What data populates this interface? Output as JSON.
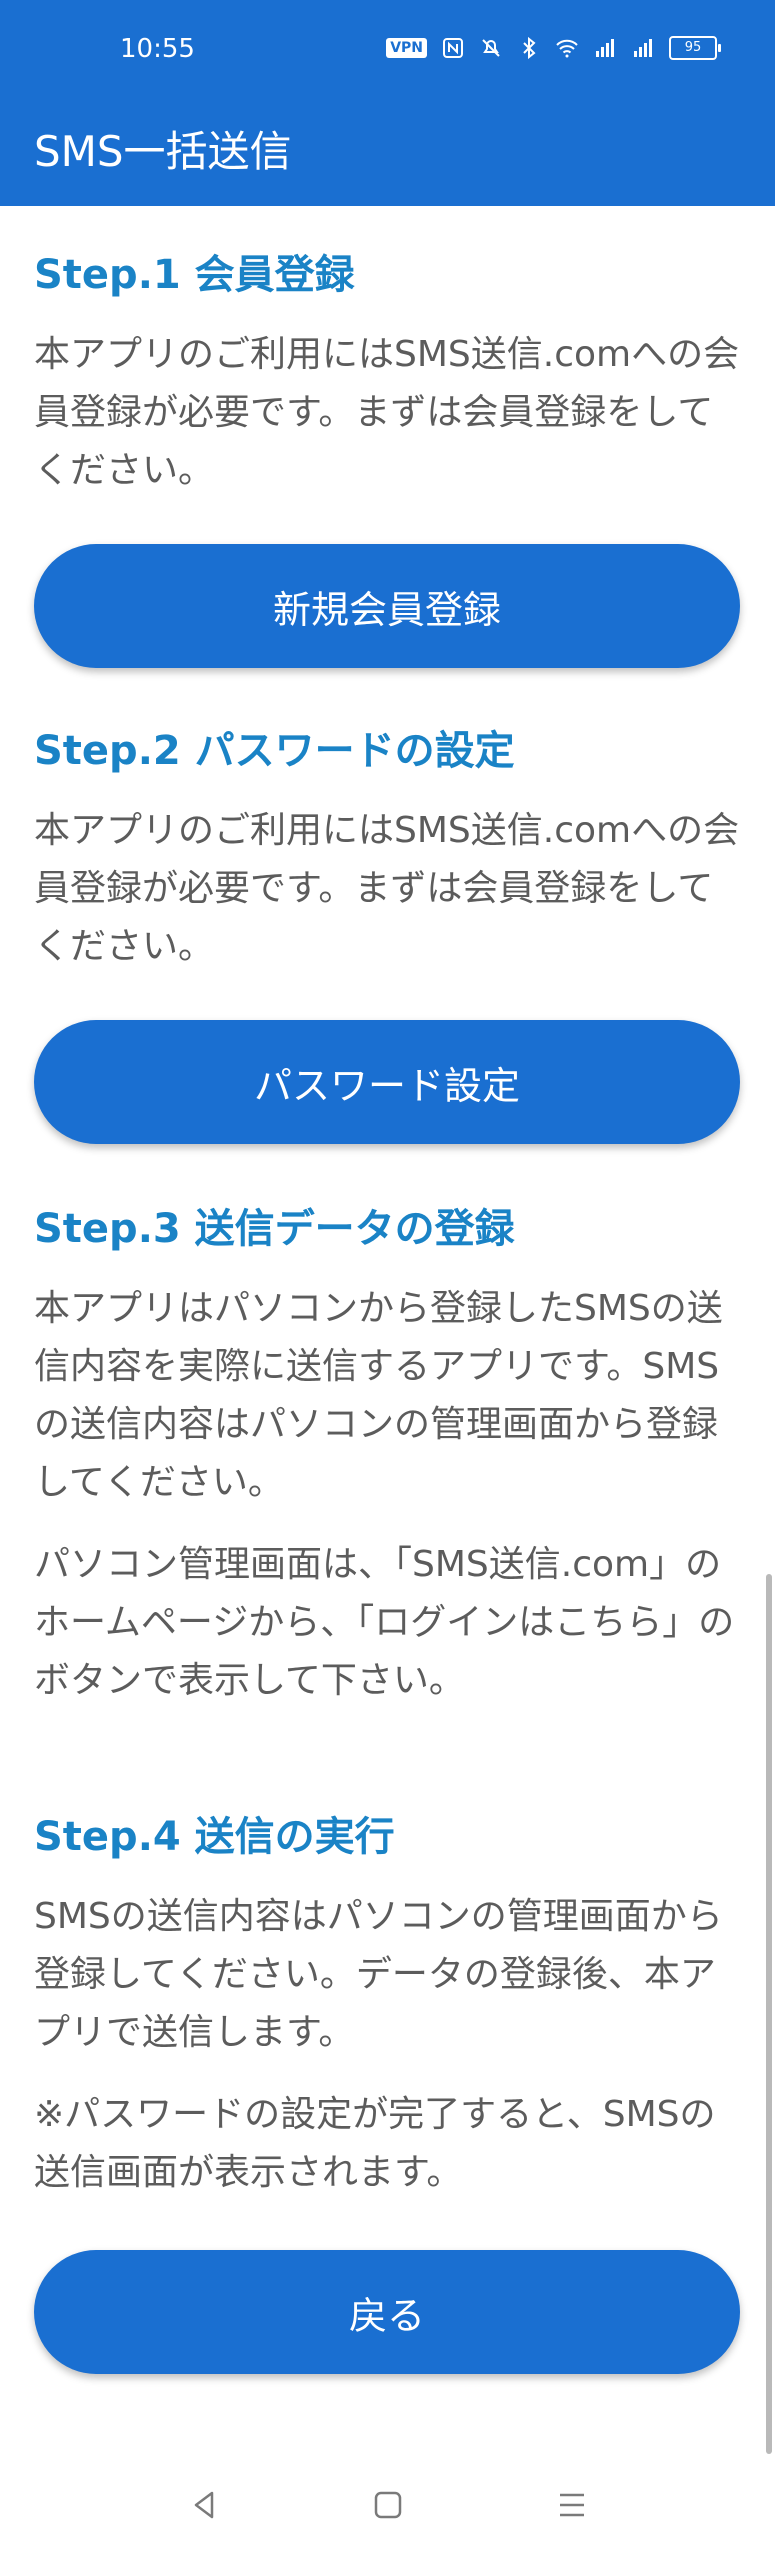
{
  "status_bar": {
    "time": "10:55",
    "vpn": "VPN",
    "battery": "95",
    "icons": [
      "nfc-icon",
      "mute-icon",
      "bluetooth-icon",
      "wifi-icon",
      "signal-icon",
      "signal-icon-2"
    ]
  },
  "header": {
    "title": "SMS一括送信"
  },
  "steps": [
    {
      "title": "Step.1 会員登録",
      "paragraphs": [
        "本アプリのご利用にはSMS送信.comへの会員登録が必要です。まずは会員登録をしてください。"
      ],
      "button": "新規会員登録"
    },
    {
      "title": "Step.2 パスワードの設定",
      "paragraphs": [
        "本アプリのご利用にはSMS送信.comへの会員登録が必要です。まずは会員登録をしてください。"
      ],
      "button": "パスワード設定"
    },
    {
      "title": "Step.3 送信データの登録",
      "paragraphs": [
        "本アプリはパソコンから登録したSMSの送信内容を実際に送信するアプリです。SMSの送信内容はパソコンの管理画面から登録してください。",
        "パソコン管理画面は、「SMS送信.com」のホームページから、「ログインはこちら」のボタンで表示して下さい。"
      ]
    },
    {
      "title": "Step.4 送信の実行",
      "paragraphs": [
        "SMSの送信内容はパソコンの管理画面から登録してください。データの登録後、本アプリで送信します。",
        "※パスワードの設定が完了すると、SMSの送信画面が表示されます。"
      ]
    }
  ],
  "back_button": "戻る",
  "colors": {
    "primary": "#1a6fd1",
    "step_title": "#1a83c6",
    "text": "#5c5c5c"
  }
}
